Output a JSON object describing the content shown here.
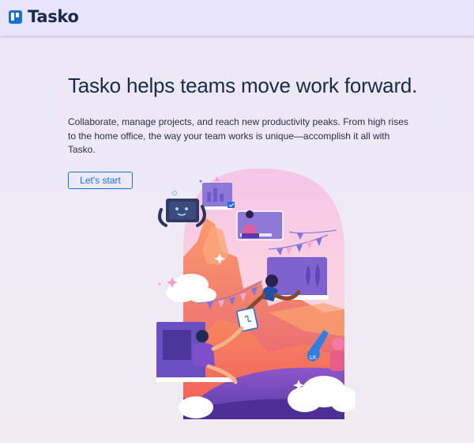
{
  "brand": {
    "name": "Tasko"
  },
  "hero": {
    "title": "Tasko helps teams move work forward.",
    "subtitle": "Collaborate, manage projects, and reach new productivity peaks. From high rises to the home office, the way your team works is unique—accomplish it all with Tasko.",
    "cta_label": "Let's start"
  },
  "colors": {
    "accent": "#1b6fd6",
    "text": "#172b4d",
    "topbar": "#e8e4fb"
  }
}
